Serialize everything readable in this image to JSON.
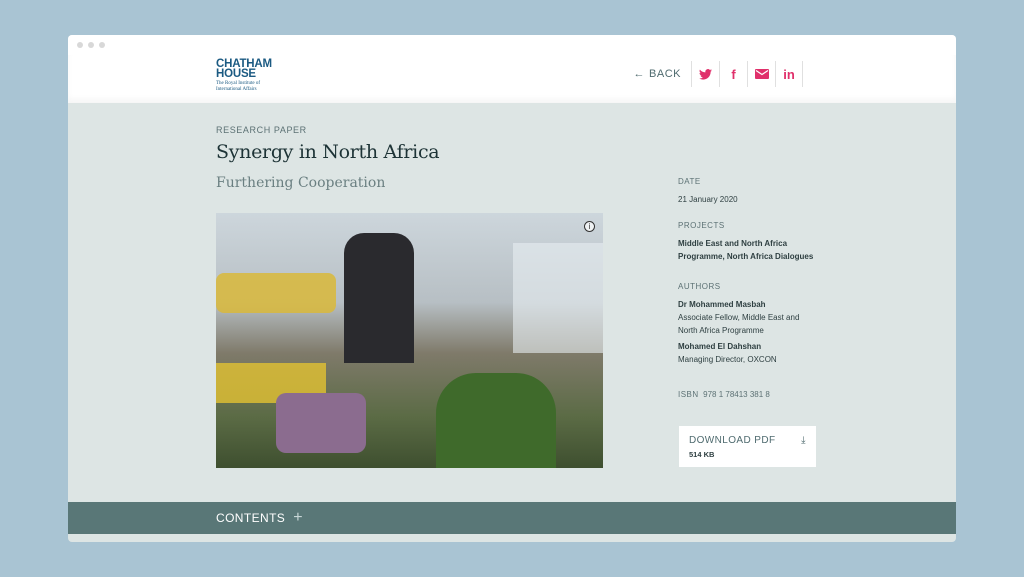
{
  "logo": {
    "line1": "CHATHAM",
    "line2": "HOUSE",
    "line3": "The Royal Institute of",
    "line4": "International Affairs"
  },
  "nav": {
    "back_label": "BACK",
    "social": [
      {
        "icon": "twitter-icon",
        "glyph": "🐦"
      },
      {
        "icon": "facebook-icon",
        "glyph": "f"
      },
      {
        "icon": "email-icon",
        "glyph": "✉"
      },
      {
        "icon": "linkedin-icon",
        "glyph": "in"
      }
    ]
  },
  "article": {
    "kicker": "RESEARCH PAPER",
    "title": "Synergy in North Africa",
    "subtitle": "Furthering Cooperation",
    "image_info_glyph": "i"
  },
  "sidebar": {
    "date_label": "DATE",
    "date": "21 January 2020",
    "projects_label": "PROJECTS",
    "projects": "Middle East and North Africa Programme, North Africa Dialogues",
    "authors_label": "AUTHORS",
    "authors": [
      {
        "name": "Dr Mohammed Masbah",
        "role": "Associate Fellow, Middle East and North Africa Programme"
      },
      {
        "name": "Mohamed El Dahshan",
        "role": "Managing Director, OXCON"
      }
    ],
    "isbn_label": "ISBN",
    "isbn": "978 1 78413 381 8"
  },
  "download": {
    "label": "DOWNLOAD PDF",
    "size": "514 KB"
  },
  "contents": {
    "label": "CONTENTS",
    "plus": "+"
  },
  "colors": {
    "accent": "#e0306b",
    "brand": "#1b5a82",
    "contents_bar": "#597777",
    "page_bg": "#dde5e4"
  }
}
